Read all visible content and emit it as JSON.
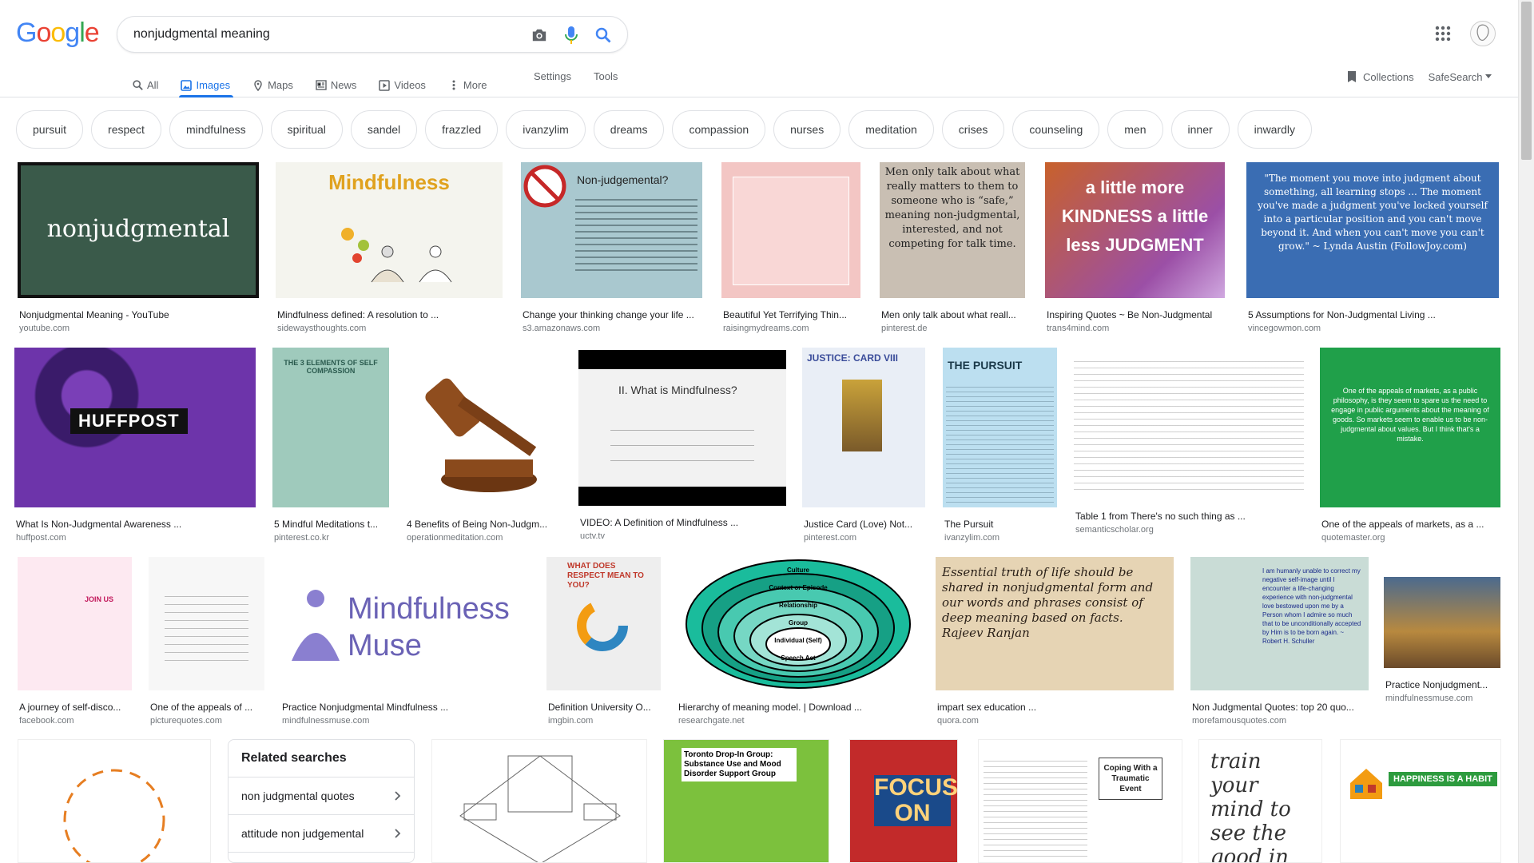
{
  "logo": {
    "letters": [
      "G",
      "o",
      "o",
      "g",
      "l",
      "e"
    ],
    "colors": [
      "#4285f4",
      "#ea4335",
      "#fbbc05",
      "#4285f4",
      "#34a853",
      "#ea4335"
    ]
  },
  "search": {
    "query": "nonjudgmental meaning"
  },
  "tabs": [
    {
      "label": "All",
      "icon": "search-icon"
    },
    {
      "label": "Images",
      "icon": "image-icon",
      "active": true
    },
    {
      "label": "Maps",
      "icon": "map-icon"
    },
    {
      "label": "News",
      "icon": "news-icon"
    },
    {
      "label": "Videos",
      "icon": "video-icon"
    },
    {
      "label": "More",
      "icon": "more-vert-icon"
    }
  ],
  "tools": {
    "settings": "Settings",
    "tools": "Tools"
  },
  "right": {
    "collections": "Collections",
    "safesearch": "SafeSearch"
  },
  "chips": [
    "pursuit",
    "respect",
    "mindfulness",
    "spiritual",
    "sandel",
    "frazzled",
    "ivanzylim",
    "dreams",
    "compassion",
    "nurses",
    "meditation",
    "crises",
    "counseling",
    "men",
    "inner",
    "inwardly"
  ],
  "images": [
    {
      "title": "Nonjudgmental Meaning - YouTube",
      "source": "youtube.com",
      "text": "nonjudgmental",
      "color": "#3a5a4a"
    },
    {
      "title": "Mindfulness defined: A resolution to ...",
      "source": "sidewaysthoughts.com",
      "text": "Mindfulness",
      "color": "#f4f4ee"
    },
    {
      "title": "Change your thinking change your life ...",
      "source": "s3.amazonaws.com",
      "text": "Non-judgemental?",
      "color": "#a9c8cf"
    },
    {
      "title": "Beautiful Yet Terrifying Thin...",
      "source": "raisingmydreams.com",
      "text": "",
      "color": "#f3c6c4"
    },
    {
      "title": "Men only talk about what reall...",
      "source": "pinterest.de",
      "text": "Men only talk about what really matters to them to someone who is “safe,” meaning non-judgmental, interested, and not competing for talk time.",
      "color": "#c9bfb3"
    },
    {
      "title": "Inspiring Quotes ~ Be Non-Judgmental",
      "source": "trans4mind.com",
      "text": "a little more KINDNESS a little less JUDGMENT",
      "color": "#c8612b"
    },
    {
      "title": "5 Assumptions for Non-Judgmental Living ...",
      "source": "vincegowmon.com",
      "text": "\"The moment you move into judgment about something, all learning stops ... The moment you've made a judgment you've locked yourself into a particular position and you can't move beyond it. And when you can't move you can't grow.\" ~ Lynda Austin (FollowJoy.com)",
      "color": "#3a6db3"
    },
    {
      "title": "What Is Non-Judgmental Awareness ...",
      "source": "huffpost.com",
      "text": "HUFFPOST",
      "color": "#5b2a8a"
    },
    {
      "title": "5 Mindful Meditations t...",
      "source": "pinterest.co.kr",
      "text": "THE 3 ELEMENTS OF SELF COMPASSION",
      "color": "#9fcabc"
    },
    {
      "title": "4 Benefits of Being Non-Judgm...",
      "source": "operationmeditation.com",
      "text": "",
      "color": "#ffffff"
    },
    {
      "title": "VIDEO: A Definition of Mindfulness ...",
      "source": "uctv.tv",
      "text": "II. What is Mindfulness?",
      "color": "#f2f2f2"
    },
    {
      "title": "Justice Card (Love) Not...",
      "source": "pinterest.com",
      "text": "JUSTICE: CARD VIII",
      "color": "#e9eef6"
    },
    {
      "title": "The Pursuit",
      "source": "ivanzylim.com",
      "text": "THE PURSUIT",
      "color": "#bcdff0"
    },
    {
      "title": "Table 1 from There's no such thing as ...",
      "source": "semanticscholar.org",
      "text": "",
      "color": "#ffffff"
    },
    {
      "title": "One of the appeals of markets, as a ...",
      "source": "quotemaster.org",
      "text": "One of the appeals of markets, as a public philosophy, is they seem to spare us the need to engage in public arguments about the meaning of goods. So markets seem to enable us to be non-judgmental about values. But I think that's a mistake.",
      "color": "#20a04a"
    },
    {
      "title": "A journey of self-disco...",
      "source": "facebook.com",
      "text": "JOIN US",
      "color": "#fde9f1"
    },
    {
      "title": "One of the appeals of ...",
      "source": "picturequotes.com",
      "text": "",
      "color": "#f7f7f7"
    },
    {
      "title": "Practice Nonjudgmental Mindfulness ...",
      "source": "mindfulnessmuse.com",
      "text": "Mindfulness Muse",
      "color": "#ffffff"
    },
    {
      "title": "Definition University O...",
      "source": "imgbin.com",
      "text": "WHAT DOES RESPECT MEAN TO YOU?",
      "color": "#eeeeee"
    },
    {
      "title": "Hierarchy of meaning model. | Download ...",
      "source": "researchgate.net",
      "text": "",
      "color": "#ffffff"
    },
    {
      "title": "impart sex education ...",
      "source": "quora.com",
      "text": "Essential truth of life should be shared in nonjudgmental form and our words and phrases consist of deep meaning based on facts. Rajeev Ranjan",
      "color": "#e6d4b4"
    },
    {
      "title": "Non Judgmental Quotes: top 20 quo...",
      "source": "morefamousquotes.com",
      "text": "I am humanly unable to correct my negative self-image until I encounter a life-changing experience with non-judgmental love bestowed upon me by a Person whom I admire so much that to be unconditionally accepted by Him is to be born again. ~ Robert H. Schuller",
      "color": "#c9dcd6"
    },
    {
      "title": "Practice Nonjudgment...",
      "source": "mindfulnessmuse.com",
      "text": "",
      "color": "#3b5b7e"
    }
  ],
  "hierarchy": [
    "Culture",
    "Context or Episode",
    "Relationship",
    "Group",
    "Individual (Self)",
    "Speech Act"
  ],
  "related": {
    "title": "Related searches",
    "items": [
      "non judgmental quotes",
      "attitude non judgemental"
    ]
  },
  "row4": [
    {
      "text": "",
      "color": "#ffffff"
    },
    {
      "text": "",
      "color": "#ffffff"
    },
    {
      "text": "Toronto Drop-In Group: Substance Use and Mood Disorder Support Group",
      "color": "#7cc13d"
    },
    {
      "text": "FOCUS ON",
      "color": "#c22a2a"
    },
    {
      "text": "Coping With a Traumatic Event",
      "color": "#ffffff"
    },
    {
      "text": "train your mind to see the good in",
      "color": "#ffffff"
    },
    {
      "text": "HAPPINESS IS A HABIT",
      "color": "#ffffff"
    }
  ]
}
